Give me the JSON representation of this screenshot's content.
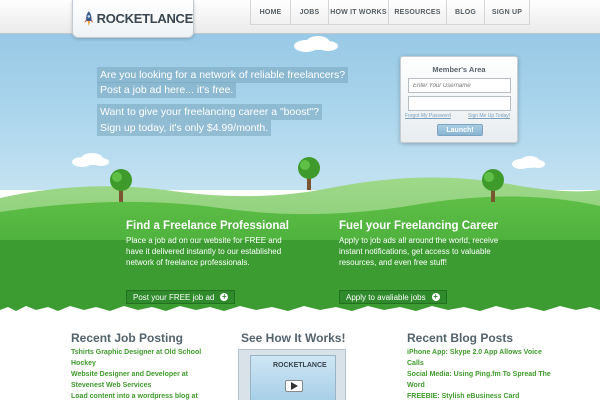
{
  "header": {
    "logo_text": "ROCKETLANCE",
    "nav": [
      {
        "label": "HOME"
      },
      {
        "label": "JOBS"
      },
      {
        "label": "HOW IT WORKS"
      },
      {
        "label": "RESOURCES"
      },
      {
        "label": "BLOG"
      },
      {
        "label": "SIGN UP"
      }
    ]
  },
  "hero": {
    "lines": [
      "Are you looking for a network of reliable freelancers?",
      "Post a job ad here... it's free.",
      "Want to give your freelancing career a \"boost\"?",
      "Sign up today, it's only $4.99/month."
    ]
  },
  "member_area": {
    "title": "Member's Area",
    "username_placeholder": "Enter Your Username",
    "password_placeholder": "",
    "forgot_link": "Forgot My Password",
    "signup_link": "Sign Me Up Today!",
    "launch_button": "Launch!"
  },
  "features": {
    "left": {
      "title": "Find a Freelance Professional",
      "body": "Place a job ad on our website for FREE and have it delivered instantly to our established network of freelance professionals.",
      "button": "Post your FREE job ad"
    },
    "right": {
      "title": "Fuel your Freelancing Career",
      "body": "Apply to job ads all around the world, receive instant notifications, get access to valuable resources, and even free stuff!",
      "button": "Apply to avaliable jobs"
    }
  },
  "recent_jobs": {
    "title": "Recent Job Posting",
    "items": [
      "Tshirts Graphic Designer at Old School",
      "Hockey",
      "Website Designer and Developer at",
      "Stevenest Web Services",
      "Load content into a wordpress blog at"
    ]
  },
  "how_it_works": {
    "title": "See How It Works!",
    "video_logo": "ROCKETLANCE"
  },
  "recent_blog": {
    "title": "Recent Blog Posts",
    "items": [
      "iPhone App: Skype 2.0 App Allows Voice",
      "Calls",
      "Social Media: Using Ping.fm To Spread The",
      "Word",
      "FREEBIE: Stylish eBusiness Card"
    ]
  },
  "colors": {
    "sky_top": "#8fc3e2",
    "grass": "#4caf3a",
    "button_green": "#2e8a2a",
    "link_green": "#3f9a2c",
    "heading_gray": "#53636d"
  }
}
